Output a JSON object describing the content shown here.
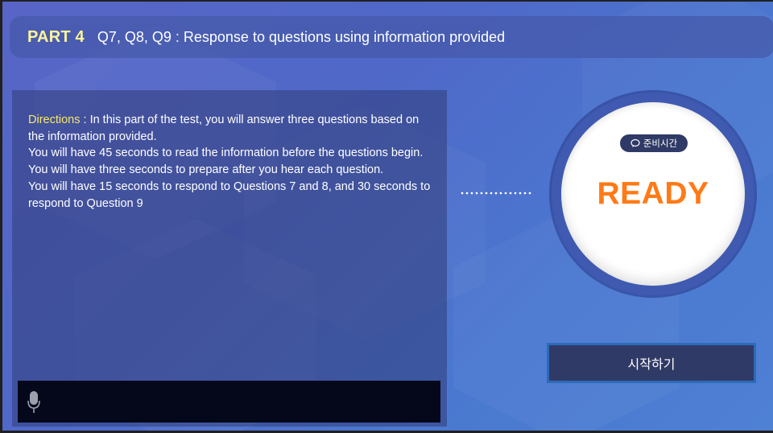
{
  "header": {
    "part_label": "PART 4",
    "title": "Q7, Q8, Q9 : Response to questions using information provided"
  },
  "directions": {
    "label": "Directions",
    "separator": " : ",
    "line1": "In this part of the test, you will answer three questions based on the information provided.",
    "line2": "You will have 45 seconds to read the information before the questions begin.",
    "line3": "You will have three seconds to prepare after you hear each question.",
    "line4": "You will have 15 seconds to respond to Questions 7 and 8, and 30 seconds to respond to Question 9"
  },
  "recorder": {
    "icon": "microphone-icon"
  },
  "timer": {
    "badge_icon": "speech-bubble-icon",
    "badge_label": "준비시간",
    "status": "READY",
    "status_color": "#ff7a17"
  },
  "actions": {
    "start_label": "시작하기"
  }
}
